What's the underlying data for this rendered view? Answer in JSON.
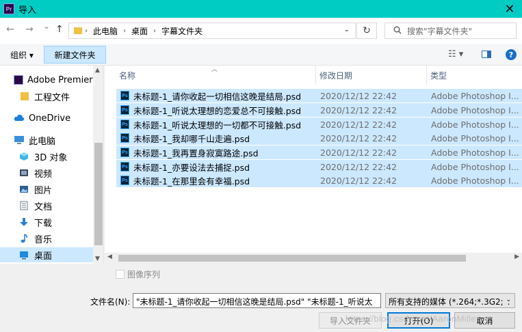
{
  "window": {
    "title": "导入",
    "app_logo": "Pr",
    "close": "✕"
  },
  "nav": {
    "back": "←",
    "forward": "→",
    "recent": "⌄",
    "up": "↑",
    "breadcrumb": [
      "此电脑",
      "桌面",
      "字幕文件夹"
    ],
    "refresh": "↻",
    "search_placeholder": "搜索\"字幕文件夹\""
  },
  "toolbar": {
    "organize": "组织 ▾",
    "new_folder": "新建文件夹",
    "help": "?"
  },
  "sidebar": {
    "items": [
      {
        "label": "Adobe Premiere",
        "icon": "premiere-icon"
      },
      {
        "label": "工程文件",
        "icon": "folder-icon"
      },
      {
        "label": "OneDrive",
        "icon": "cloud-icon"
      },
      {
        "label": "此电脑",
        "icon": "computer-icon"
      },
      {
        "label": "3D 对象",
        "icon": "cube-icon"
      },
      {
        "label": "视频",
        "icon": "video-icon"
      },
      {
        "label": "图片",
        "icon": "pictures-icon"
      },
      {
        "label": "文档",
        "icon": "documents-icon"
      },
      {
        "label": "下载",
        "icon": "download-icon"
      },
      {
        "label": "音乐",
        "icon": "music-icon"
      },
      {
        "label": "桌面",
        "icon": "desktop-icon"
      }
    ]
  },
  "files": {
    "columns": [
      "名称",
      "修改日期",
      "类型"
    ],
    "rows": [
      {
        "name": "未标题-1_请你收起一切相信这晚是结局.psd",
        "date": "2020/12/12 22:42",
        "type": "Adobe Photoshop I..."
      },
      {
        "name": "未标题-1_听说太理想的恋爱总不可接触.psd",
        "date": "2020/12/12 22:42",
        "type": "Adobe Photoshop I..."
      },
      {
        "name": "未标题-1_听说太理想的一切都不可接触.psd",
        "date": "2020/12/12 22:42",
        "type": "Adobe Photoshop I..."
      },
      {
        "name": "未标题-1_我却哪千山走遍.psd",
        "date": "2020/12/12 22:42",
        "type": "Adobe Photoshop I..."
      },
      {
        "name": "未标题-1_我再置身寂寞路途.psd",
        "date": "2020/12/12 22:42",
        "type": "Adobe Photoshop I..."
      },
      {
        "name": "未标题-1_亦要设法去捕捉.psd",
        "date": "2020/12/12 22:42",
        "type": "Adobe Photoshop I..."
      },
      {
        "name": "未标题-1_在那里会有幸福.psd",
        "date": "2020/12/12 22:42",
        "type": "Adobe Photoshop I..."
      }
    ]
  },
  "bottom": {
    "image_sequence": "图像序列",
    "filename_label": "文件名(N):",
    "filename_value": "\"未标题-1_请你收起一切相信这晚是结局.psd\" \"未标题-1_听说太",
    "filetype": "所有支持的媒体 (*.264;*.3G2;*.",
    "import_folder": "导入文件夹",
    "open": "打开(O)",
    "cancel": "取消",
    "watermark": "https://blog.csdn.net/AaronMiller"
  }
}
